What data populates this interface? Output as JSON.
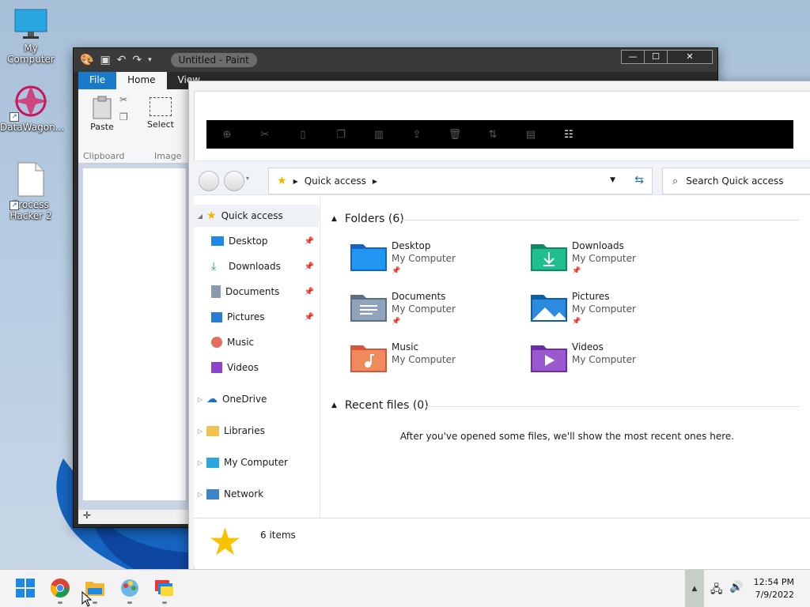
{
  "desktop": {
    "icons": [
      {
        "label": "My Computer"
      },
      {
        "label": "DataWagon..."
      },
      {
        "label": "Process Hacker 2"
      }
    ]
  },
  "paint": {
    "title": "Untitled - Paint",
    "tabs": [
      "File",
      "Home",
      "View"
    ],
    "ribbon": {
      "paste": "Paste",
      "select": "Select",
      "clipboard": "Clipboard",
      "image": "Image"
    }
  },
  "explorer": {
    "address": {
      "location": "Quick access"
    },
    "search": {
      "placeholder": "Search Quick access"
    },
    "nav": {
      "quick_access": "Quick access",
      "items": [
        "Desktop",
        "Downloads",
        "Documents",
        "Pictures",
        "Music",
        "Videos"
      ],
      "onedrive": "OneDrive",
      "libraries": "Libraries",
      "my_computer": "My Computer",
      "network": "Network"
    },
    "folders_header": "Folders (6)",
    "folders": [
      {
        "name": "Desktop",
        "location": "My Computer"
      },
      {
        "name": "Downloads",
        "location": "My Computer"
      },
      {
        "name": "Documents",
        "location": "My Computer"
      },
      {
        "name": "Pictures",
        "location": "My Computer"
      },
      {
        "name": "Music",
        "location": "My Computer"
      },
      {
        "name": "Videos",
        "location": "My Computer"
      }
    ],
    "recent_header": "Recent files (0)",
    "recent_empty": "After you've opened some files, we'll show the most recent ones here.",
    "status": "6 items"
  },
  "taskbar": {
    "time": "12:54 PM",
    "date": "7/9/2022"
  },
  "colors": {
    "accent": "#1979ca",
    "folder_blue": "#1e88e5",
    "taskbar": "#f3f3f3"
  }
}
